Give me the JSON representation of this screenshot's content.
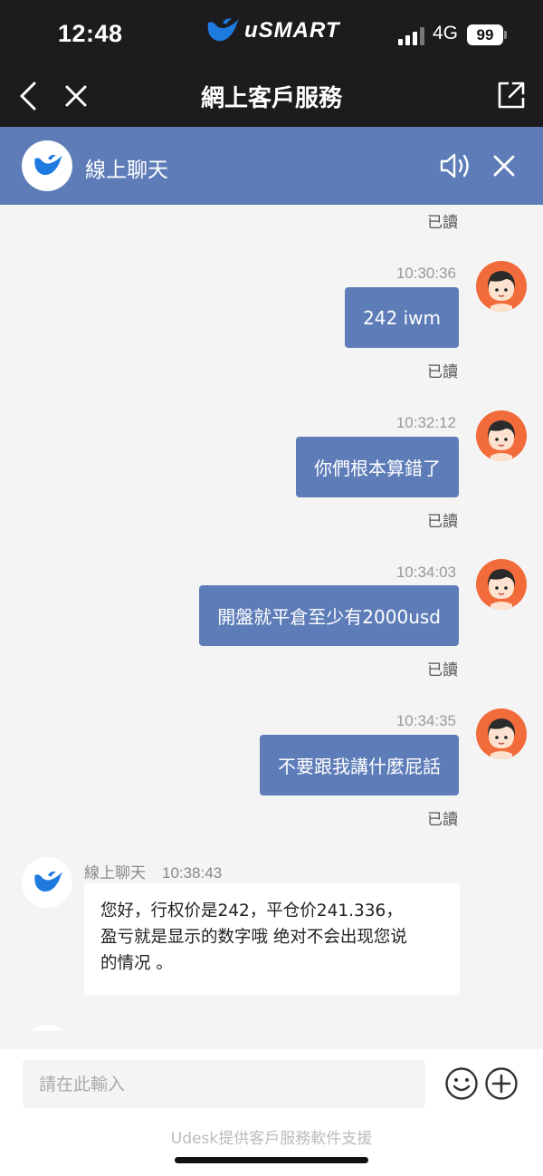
{
  "status_bar": {
    "time": "12:48",
    "brand": "uSMART",
    "network": "4G",
    "battery": "99"
  },
  "nav": {
    "title": "網上客戶服務",
    "back_icon": "chevron-left-icon",
    "close_icon": "close-icon",
    "share_icon": "external-link-icon"
  },
  "chat_header": {
    "title": "線上聊天",
    "sound_icon": "speaker-icon",
    "close_icon": "close-icon"
  },
  "colors": {
    "accent": "#5e7db8",
    "dark_bar": "#1c1c1e",
    "avatar_bg": "#f26b3a",
    "brand_blue": "#1f7ae0"
  },
  "messages": {
    "top_read": "已讀",
    "outgoing": [
      {
        "time": "10:30:36",
        "text": "242 iwm",
        "read": "已讀"
      },
      {
        "time": "10:32:12",
        "text": "你們根本算錯了",
        "read": "已讀"
      },
      {
        "time": "10:34:03",
        "text": "開盤就平倉至少有2000usd",
        "read": "已讀"
      },
      {
        "time": "10:34:35",
        "text": "不要跟我講什麼屁話",
        "read": "已讀"
      }
    ],
    "incoming": [
      {
        "sender": "線上聊天",
        "time": "10:38:43",
        "lines": [
          "您好，行权价是242，平仓价241.336，",
          "盈亏就是显示的数字哦 绝对不会出现您说",
          "的情况 。"
        ]
      }
    ]
  },
  "input": {
    "placeholder": "請在此輸入",
    "emoji_icon": "emoji-icon",
    "plus_icon": "plus-icon",
    "powered_by": "Udesk提供客戶服務軟件支援"
  }
}
